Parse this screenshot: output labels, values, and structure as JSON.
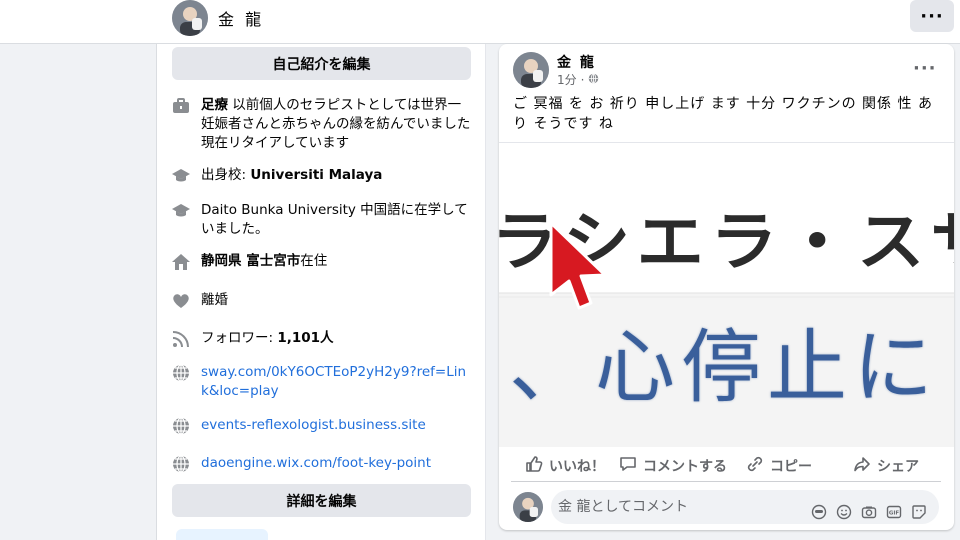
{
  "header": {
    "name": "金 龍",
    "more_label": "···"
  },
  "intro": {
    "edit_bio_label": "自己紹介を編集",
    "work": {
      "bold": "足療",
      "text": " 以前個人のセラピストとしては世界一妊娠者さんと赤ちゃんの縁を紡んでいました　現在リタイアしています"
    },
    "education1": {
      "prefix": "出身校: ",
      "bold": "Universiti Malaya"
    },
    "education2": "Daito Bunka University 中国語に在学していました。",
    "home": {
      "bold": "静岡県 富士宮市",
      "suffix": "在住"
    },
    "relationship": "離婚",
    "followers": {
      "prefix": "フォロワー: ",
      "bold": "1,101人"
    },
    "links": [
      "sway.com/0kY6OCTEoP2yH2y9?ref=Link&loc=play",
      "events-reflexologist.business.site",
      "daoengine.wix.com/foot-key-point"
    ],
    "edit_details_label": "詳細を編集"
  },
  "post": {
    "author": "金 龍",
    "time": "1分",
    "text": "ご 冥福 を お 祈り 申し上げ ます 十分 ワクチンの 関係 性 あり そうです ね",
    "image_text_top": "ラシエラ・スサ",
    "image_text_bottom": "、心停止に",
    "actions": {
      "like": "いいね！",
      "comment": "コメントする",
      "copy": "コピー",
      "share": "シェア"
    },
    "comment_placeholder": "金 龍としてコメント"
  },
  "colors": {
    "link": "#216fdb",
    "background": "#f0f2f5",
    "cursor": "#d71921",
    "image_blue": "#3a5f9b"
  },
  "icons": [
    "briefcase-icon",
    "graduation-cap-icon",
    "home-icon",
    "heart-icon",
    "rss-icon",
    "globe-icon",
    "like-icon",
    "comment-icon",
    "copy-icon",
    "share-icon",
    "globe-privacy-icon",
    "avatar-sticker-icon",
    "emoji-icon",
    "camera-icon",
    "gif-icon",
    "sticker-icon",
    "cursor-arrow-icon"
  ]
}
